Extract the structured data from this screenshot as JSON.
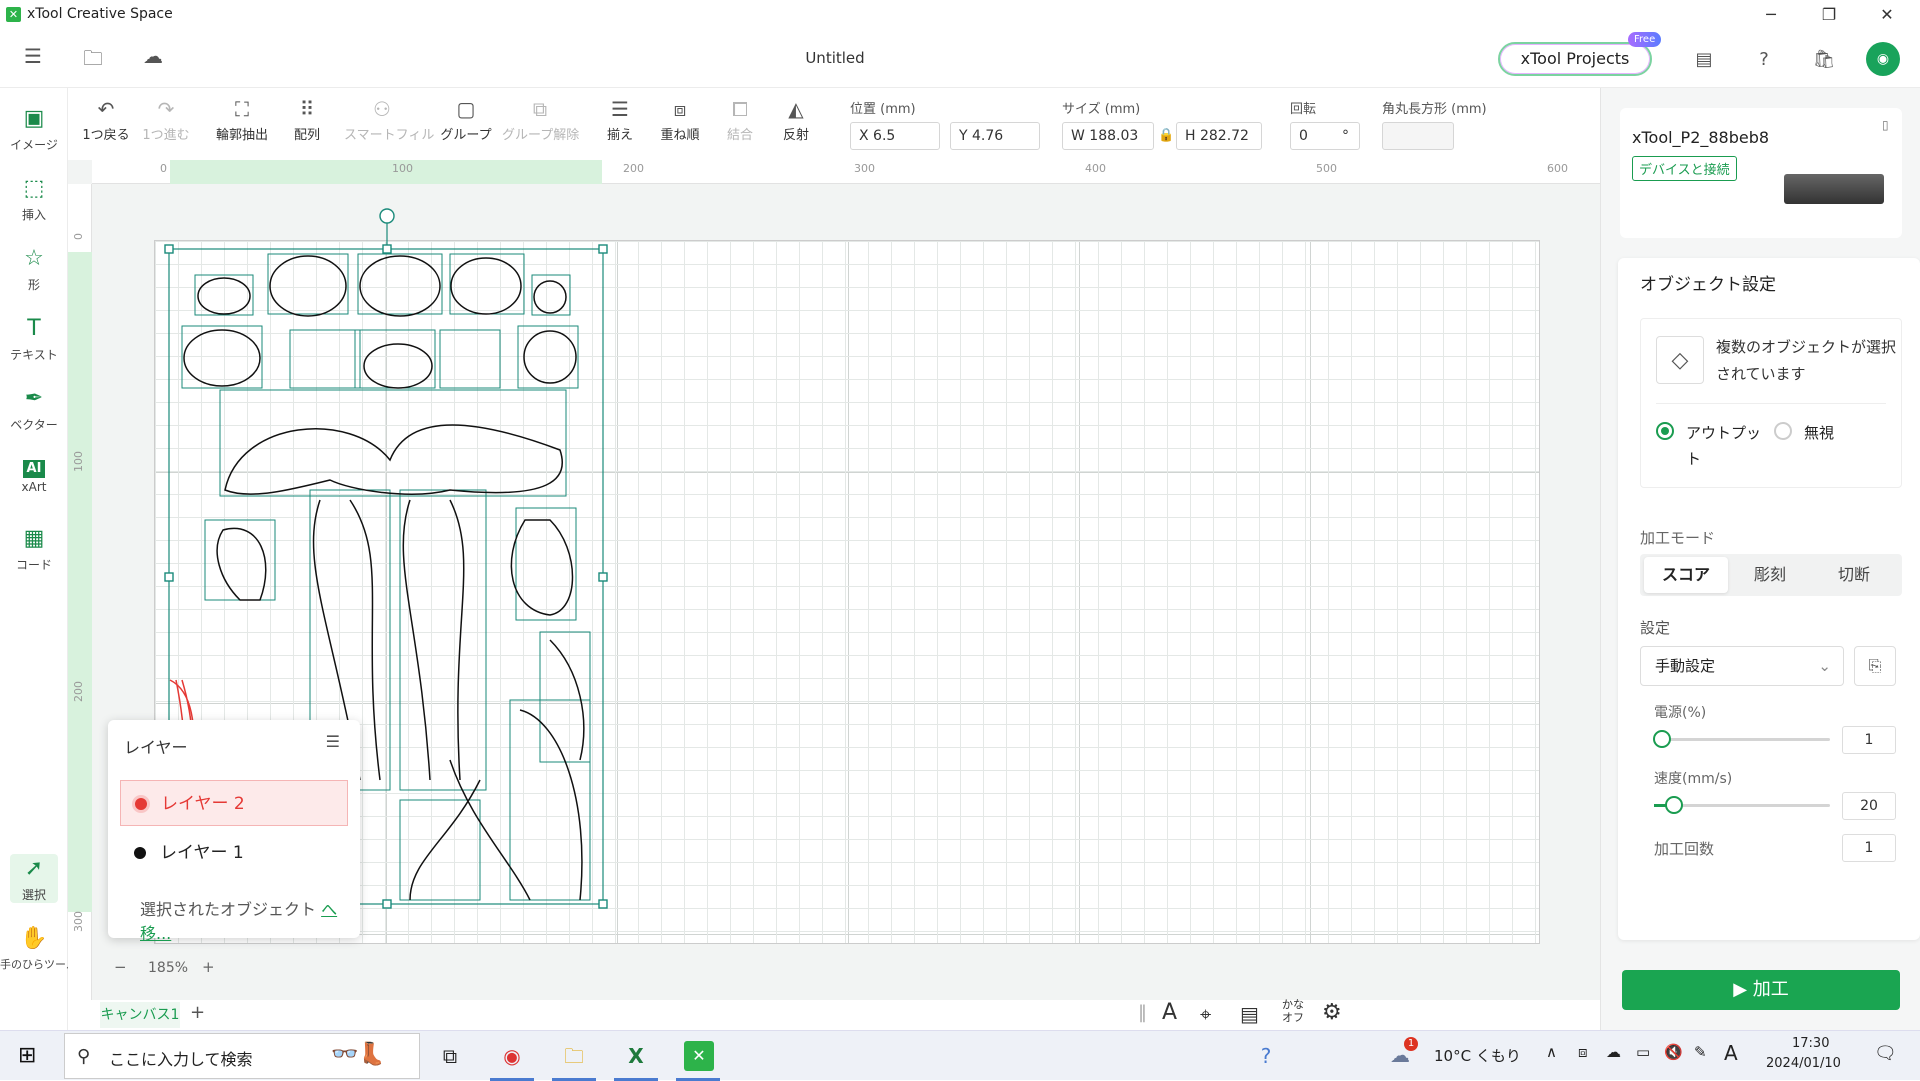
{
  "app": {
    "title": "xTool Creative Space",
    "doc_title": "Untitled"
  },
  "header": {
    "projects_label": "xTool Projects",
    "free_badge": "Free"
  },
  "left_tools": [
    {
      "label": "イメージ"
    },
    {
      "label": "挿入"
    },
    {
      "label": "形"
    },
    {
      "label": "テキスト"
    },
    {
      "label": "ベクター"
    },
    {
      "label": "xArt"
    },
    {
      "label": "コード"
    },
    {
      "label": "選択"
    },
    {
      "label": "手のひらツール"
    }
  ],
  "toolbar": {
    "undo": "1つ戻る",
    "redo": "1つ進む",
    "outline": "輪郭抽出",
    "array": "配列",
    "smartfill": "スマートフィル",
    "group": "グループ",
    "ungroup": "グループ解除",
    "align": "揃え",
    "arrange": "重ね順",
    "combine": "結合",
    "flip": "反射",
    "position_label": "位置 (mm)",
    "x": "X 6.5",
    "y": "Y 4.76",
    "size_label": "サイズ (mm)",
    "w": "W 188.03",
    "h": "H 282.72",
    "rotate_label": "回転",
    "rotate": "0",
    "deg": "°",
    "corner_label": "角丸長方形 (mm)"
  },
  "rulers": {
    "h": [
      "0",
      "100",
      "200",
      "300",
      "400",
      "500",
      "600"
    ],
    "v": [
      "0",
      "100",
      "200",
      "300"
    ]
  },
  "layers_panel": {
    "title": "レイヤー",
    "items": [
      {
        "label": "レイヤー 2",
        "color": "#e53935"
      },
      {
        "label": "レイヤー 1",
        "color": "#111111"
      }
    ],
    "footer_text": "選択されたオブジェクト",
    "footer_link": "へ移..."
  },
  "zoom": {
    "minus": "−",
    "value": "185%",
    "plus": "+"
  },
  "canvas_tabs": {
    "tab": "キャンバス1",
    "add": "+"
  },
  "bottom_tools": {
    "kana": "かな\nオフ"
  },
  "device": {
    "name": "xTool_P2_88beb8",
    "connect_label": "デバイスと接続"
  },
  "object_settings": {
    "title": "オブジェクト設定",
    "multi_selected": "複数のオブジェクトが選択されています",
    "output_label": "アウトプット",
    "ignore_label": "無視",
    "mode_label": "加工モード",
    "modes": [
      "スコア",
      "彫刻",
      "切断"
    ],
    "settings_label": "設定",
    "settings_value": "手動設定",
    "power_label": "電源(%)",
    "power_value": "1",
    "speed_label": "速度(mm/s)",
    "speed_value": "20",
    "passes_label": "加工回数",
    "passes_value": "1"
  },
  "process_button": "加工",
  "taskbar": {
    "search_placeholder": "ここに入力して検索",
    "weather": "10°C くもり",
    "ime": "A",
    "time": "17:30",
    "date": "2024/01/10",
    "notif_count": "1"
  },
  "colors": {
    "accent": "#1aa551",
    "selection": "#1a8a7a",
    "layer2": "#e53935"
  }
}
